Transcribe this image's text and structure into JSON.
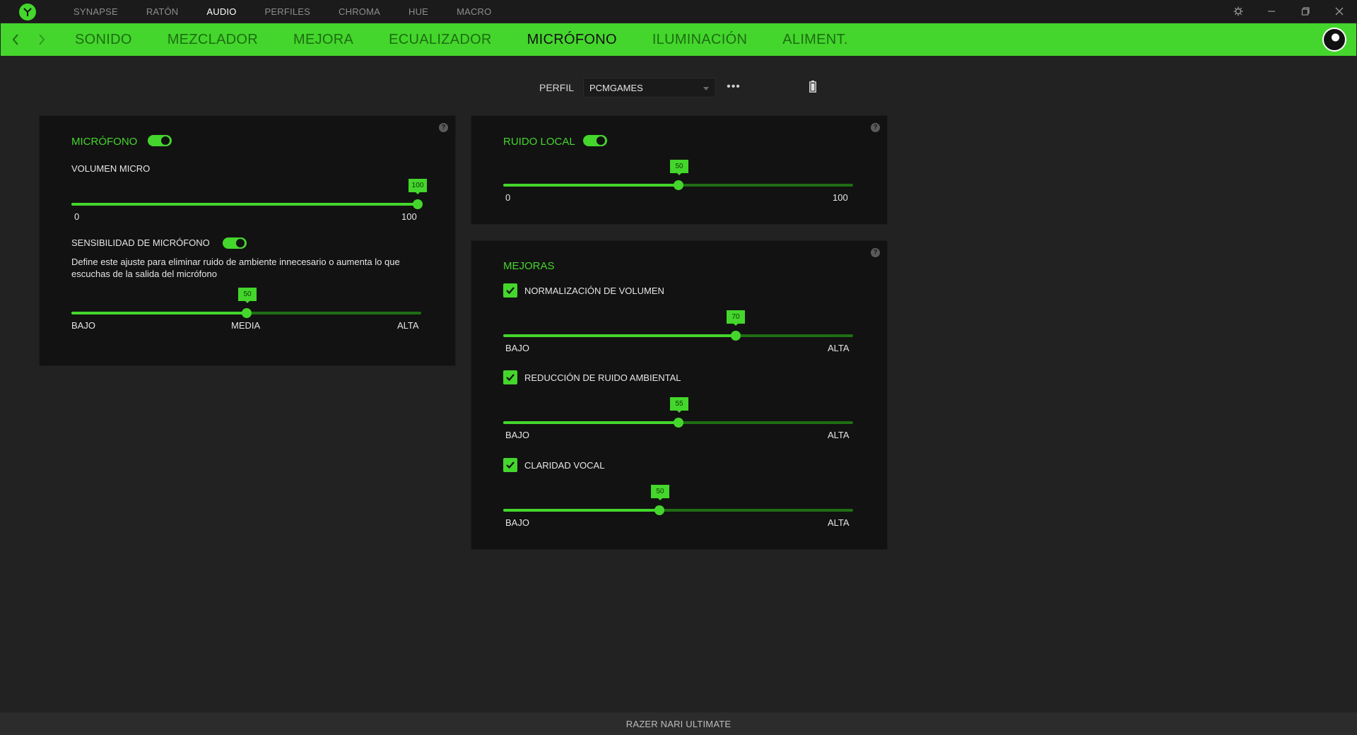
{
  "app": {
    "top_nav": [
      "SYNAPSE",
      "RATÓN",
      "AUDIO",
      "PERFILES",
      "CHROMA",
      "HUE",
      "MACRO"
    ],
    "active_top_nav": "AUDIO",
    "sub_nav": [
      "SONIDO",
      "MEZCLADOR",
      "MEJORA",
      "ECUALIZADOR",
      "MICRÓFONO",
      "ILUMINACIÓN",
      "ALIMENT."
    ],
    "active_sub_nav": "MICRÓFONO",
    "accent_color": "#44d62c"
  },
  "profile": {
    "label": "PERFIL",
    "selected": "PCMGAMES",
    "more": "•••"
  },
  "mic_panel": {
    "title": "MICRÓFONO",
    "enabled": true,
    "volume_label": "VOLUMEN MICRO",
    "volume_value": "100",
    "volume_min": "0",
    "volume_max": "100",
    "sensitivity_label": "SENSIBILIDAD DE MICRÓFONO",
    "sensitivity_enabled": true,
    "sensitivity_desc": "Define este ajuste para eliminar ruido de ambiente innecesario o aumenta lo que escuchas de la salida del micrófono",
    "sensitivity_value": "50",
    "sensitivity_low": "BAJO",
    "sensitivity_mid": "MEDIA",
    "sensitivity_high": "ALTA"
  },
  "local_noise_panel": {
    "title": "RUIDO LOCAL",
    "enabled": true,
    "value": "50",
    "min": "0",
    "max": "100"
  },
  "enhancements_panel": {
    "title": "MEJORAS",
    "items": [
      {
        "label": "NORMALIZACIÓN DE VOLUMEN",
        "checked": true,
        "value": "70",
        "low": "BAJO",
        "high": "ALTA"
      },
      {
        "label": "REDUCCIÓN DE RUIDO AMBIENTAL",
        "checked": true,
        "value": "55",
        "low": "BAJO",
        "high": "ALTA"
      },
      {
        "label": "CLARIDAD VOCAL",
        "checked": true,
        "value": "50",
        "low": "BAJO",
        "high": "ALTA"
      }
    ]
  },
  "help_icon": "?",
  "status": {
    "device": "RAZER NARI ULTIMATE"
  }
}
